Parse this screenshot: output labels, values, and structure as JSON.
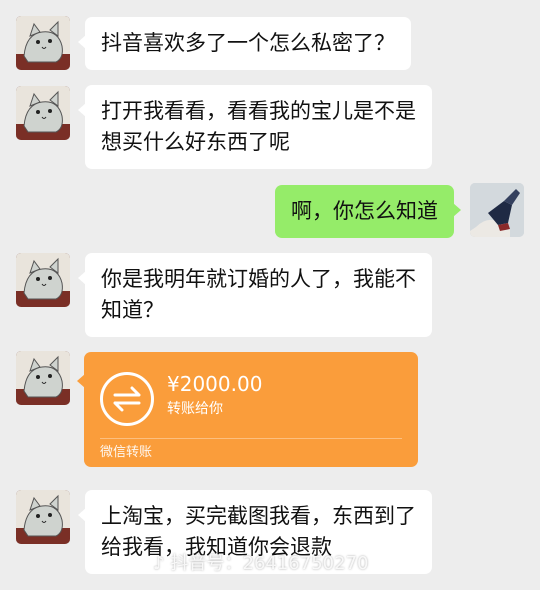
{
  "messages": [
    {
      "side": "left",
      "lines": [
        "抖音喜欢多了一个怎么私密了？"
      ]
    },
    {
      "side": "left",
      "lines": [
        "打开我看看，看看我的宝儿是不是",
        "想买什么好东西了呢"
      ]
    },
    {
      "side": "right",
      "lines": [
        "啊，你怎么知道"
      ]
    },
    {
      "side": "left",
      "lines": [
        "你是我明年就订婚的人了，我能不",
        "知道？"
      ]
    },
    {
      "side": "left",
      "lines": [
        "上淘宝，买完截图我看，东西到了",
        "给我看，我知道你会退款"
      ]
    }
  ],
  "transfer": {
    "amount": "¥2000.00",
    "subtitle": "转账给你",
    "footer": "微信转账",
    "icon": "transfer-arrows-icon",
    "color": "#fa9d3b"
  },
  "watermark": {
    "icon": "tiktok-logo-icon",
    "text": "抖音号：26416750270"
  },
  "colors": {
    "background": "#ededed",
    "left_bubble": "#ffffff",
    "right_bubble": "#95ec69"
  }
}
